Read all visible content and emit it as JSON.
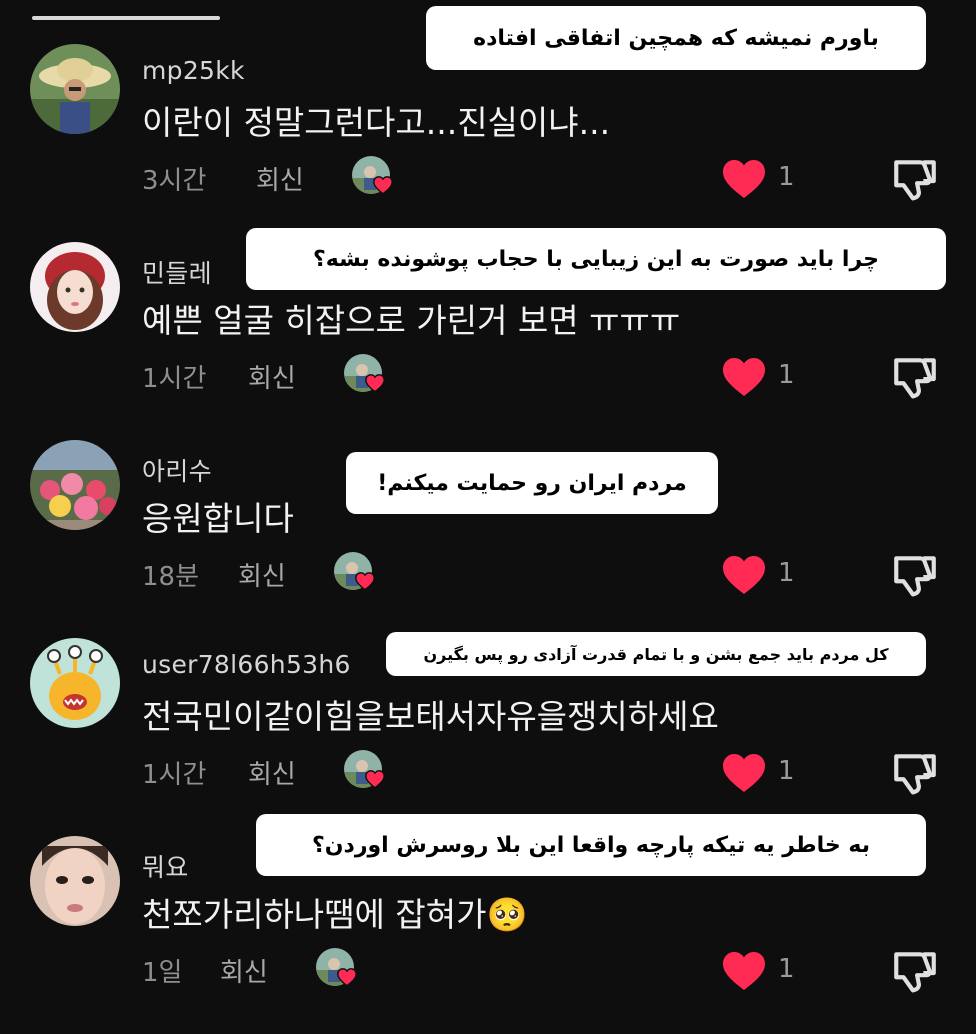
{
  "comments": [
    {
      "username": "mp25kk",
      "text": "이란이 정말그런다고...진실이냐...",
      "time": "3시간",
      "reply": "회신",
      "likes": "1",
      "overlay": "باورم نمیشه که همچین اتفاقی افتاده"
    },
    {
      "username": "민들레",
      "text": "예쁜 얼굴 히잡으로 가린거 보면 ㅠㅠㅠ",
      "time": "1시간",
      "reply": "회신",
      "likes": "1",
      "overlay": "چرا باید صورت به این زیبایی با حجاب پوشونده بشه؟"
    },
    {
      "username": "아리수",
      "text": "응원합니다",
      "time": "18분",
      "reply": "회신",
      "likes": "1",
      "overlay": "مردم ایران رو حمایت میکنم!"
    },
    {
      "username": "user78l66h53h6",
      "text": "전국민이같이힘을보태서자유을쟁치하세요",
      "time": "1시간",
      "reply": "회신",
      "likes": "1",
      "overlay": "کل مردم باید جمع بشن و با تمام قدرت آزادی رو پس بگیرن"
    },
    {
      "username": "뭐요",
      "text": "천쪼가리하나땜에 잡혀가🥺",
      "time": "1일",
      "reply": "회신",
      "likes": "1",
      "overlay": "به خاطر یه تیکه پارچه واقعا این بلا روسرش اوردن؟"
    }
  ],
  "colors": {
    "background": "#0e0e0e",
    "heart": "#ff2b55",
    "overlay_bg": "#ffffff"
  },
  "icons": {
    "like": "heart-icon",
    "dislike": "thumbs-down-icon"
  }
}
